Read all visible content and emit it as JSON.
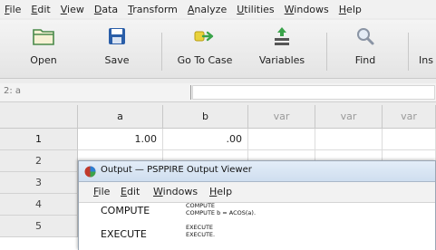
{
  "menubar": {
    "items": [
      {
        "first": "F",
        "rest": "ile"
      },
      {
        "first": "E",
        "rest": "dit"
      },
      {
        "first": "V",
        "rest": "iew"
      },
      {
        "first": "D",
        "rest": "ata"
      },
      {
        "first": "T",
        "rest": "ransform"
      },
      {
        "first": "A",
        "rest": "nalyze"
      },
      {
        "first": "U",
        "rest": "tilities"
      },
      {
        "first": "W",
        "rest": "indows"
      },
      {
        "first": "H",
        "rest": "elp"
      }
    ]
  },
  "toolbar": {
    "open_label": "Open",
    "save_label": "Save",
    "goto_label": "Go To Case",
    "variables_label": "Variables",
    "find_label": "Find",
    "insert_label_partial": "Ins"
  },
  "cell_ref": "2: a",
  "grid": {
    "columns": [
      "a",
      "b",
      "var",
      "var",
      "var"
    ],
    "rows": [
      "1",
      "2",
      "3",
      "4",
      "5"
    ],
    "row1_values": [
      "1.00",
      ".00"
    ]
  },
  "output_window": {
    "title": "Output — PSPPIRE Output Viewer",
    "menu": [
      {
        "first": "F",
        "rest": "ile"
      },
      {
        "first": "E",
        "rest": "dit"
      },
      {
        "first": "W",
        "rest": "indows"
      },
      {
        "first": "H",
        "rest": "elp"
      }
    ],
    "entries": [
      {
        "command": "COMPUTE",
        "source_line1": "COMPUTE",
        "source_line2": "COMPUTE b = ACOS(a)."
      },
      {
        "command": "EXECUTE",
        "source_line1": "EXECUTE",
        "source_line2": "EXECUTE."
      }
    ]
  },
  "colors": {
    "accent_green": "#3aa34a",
    "save_blue": "#2a5ea8",
    "title_bar": "#d6e4f3"
  }
}
